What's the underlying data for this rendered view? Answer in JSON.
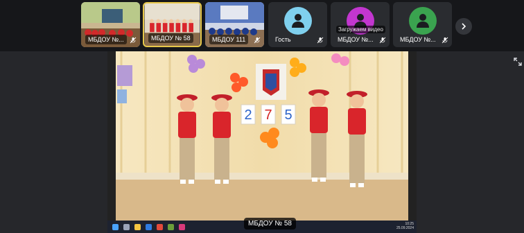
{
  "participants": [
    {
      "name": "МБДОУ №...",
      "type": "video",
      "scene": "hall-blue"
    },
    {
      "name": "МБДОУ № 58",
      "type": "video",
      "scene": "children-red",
      "active": true
    },
    {
      "name": "МБДОУ 111",
      "type": "video",
      "scene": "classroom-blue"
    },
    {
      "name": "Гость",
      "type": "avatar",
      "color": "#7fd0ee"
    },
    {
      "name": "МБДОУ №...",
      "type": "avatar",
      "color": "#c236cf",
      "status": "Загружаем видео"
    },
    {
      "name": "МБДОУ №...",
      "type": "avatar",
      "color": "#3aa34f"
    }
  ],
  "main_view": {
    "label": "МБДОУ № 58",
    "banner_number": "275",
    "taskbar_time": "10:25",
    "taskbar_date": "25.09.2024"
  },
  "colors": {
    "background": "#151618",
    "stage": "#26272b",
    "active_border": "#e8c84a",
    "uniform_red": "#d9252b",
    "uniform_beige": "#c9b28d"
  }
}
